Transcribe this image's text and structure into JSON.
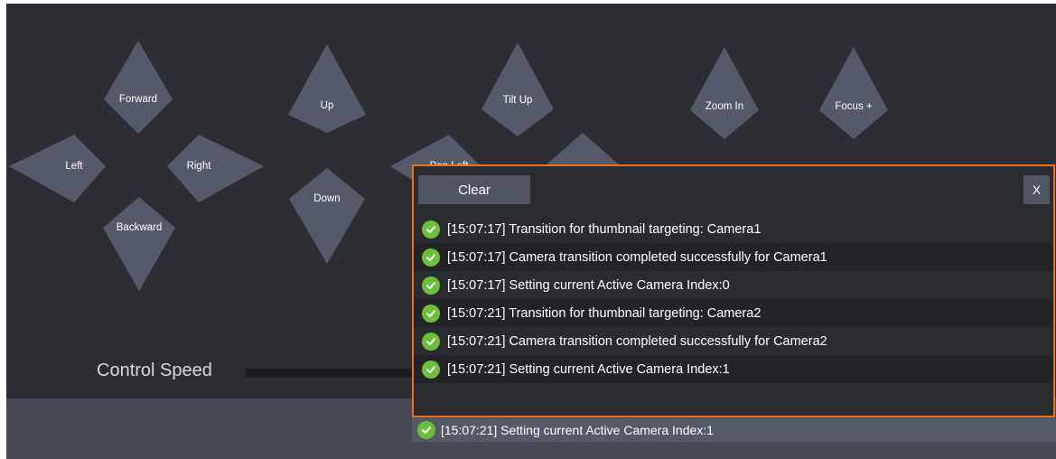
{
  "ptz_controls": {
    "forward": "Forward",
    "left": "Left",
    "right": "Right",
    "backward": "Backward",
    "up": "Up",
    "down": "Down",
    "tilt_up": "Tilt Up",
    "pan_left_partial": "Pan Left",
    "zoom_in": "Zoom In",
    "focus_plus": "Focus +"
  },
  "control_speed": {
    "label": "Control Speed"
  },
  "log_panel": {
    "clear_label": "Clear",
    "close_label": "X",
    "entries": [
      "[15:07:17] Transition for thumbnail targeting: Camera1",
      "[15:07:17] Camera transition completed successfully for Camera1",
      "[15:07:17] Setting current Active Camera Index:0",
      "[15:07:21] Transition for thumbnail targeting: Camera2",
      "[15:07:21] Camera transition completed successfully for Camera2",
      "[15:07:21] Setting current Active Camera Index:1"
    ]
  },
  "status_bar": {
    "last_message": "[15:07:21] Setting current Active Camera Index:1"
  },
  "colors": {
    "background": "#2c2e33",
    "control_fill": "#545a6a",
    "accent_border": "#e8731a",
    "success": "#6cbf3c"
  }
}
